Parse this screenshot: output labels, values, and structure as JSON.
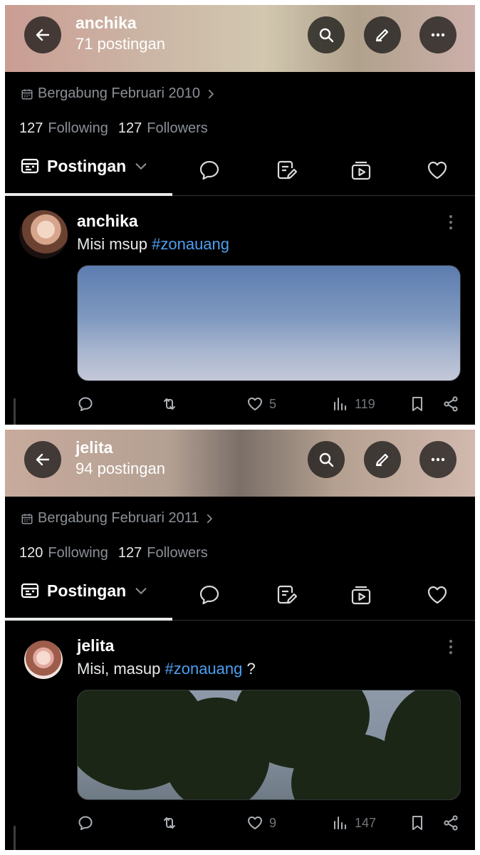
{
  "panels": [
    {
      "header": {
        "name": "anchika",
        "post_count": "71 postingan"
      },
      "profile": {
        "joined": "Bergabung Februari 2010",
        "following_count": "127",
        "following_label": "Following",
        "followers_count": "127",
        "followers_label": "Followers"
      },
      "tabs": {
        "active_label": "Postingan"
      },
      "post": {
        "author": "anchika",
        "text_before": "Misi msup ",
        "hashtag": "#zonauang",
        "text_after": "",
        "likes": "5",
        "views": "119"
      }
    },
    {
      "header": {
        "name": "jelita",
        "post_count": "94 postingan"
      },
      "profile": {
        "joined": "Bergabung Februari 2011",
        "following_count": "120",
        "following_label": "Following",
        "followers_count": "127",
        "followers_label": "Followers"
      },
      "tabs": {
        "active_label": "Postingan"
      },
      "post": {
        "author": "jelita",
        "text_before": "Misi, masup ",
        "hashtag": "#zonauang",
        "text_after": " ?",
        "likes": "9",
        "views": "147"
      }
    }
  ],
  "icons": {
    "back": "arrow-left-icon",
    "search": "search-icon",
    "edit": "pencil-icon",
    "more": "more-horizontal-icon",
    "calendar": "calendar-icon",
    "chevron": "chevron-right-icon",
    "posts_tab": "posts-tab-icon",
    "replies_tab": "speech-bubble-icon",
    "articles_tab": "article-edit-icon",
    "media_tab": "media-play-icon",
    "likes_tab": "heart-icon"
  },
  "colors": {
    "background": "#000000",
    "hashtag": "#4c9ff0",
    "muted": "#71767b"
  }
}
